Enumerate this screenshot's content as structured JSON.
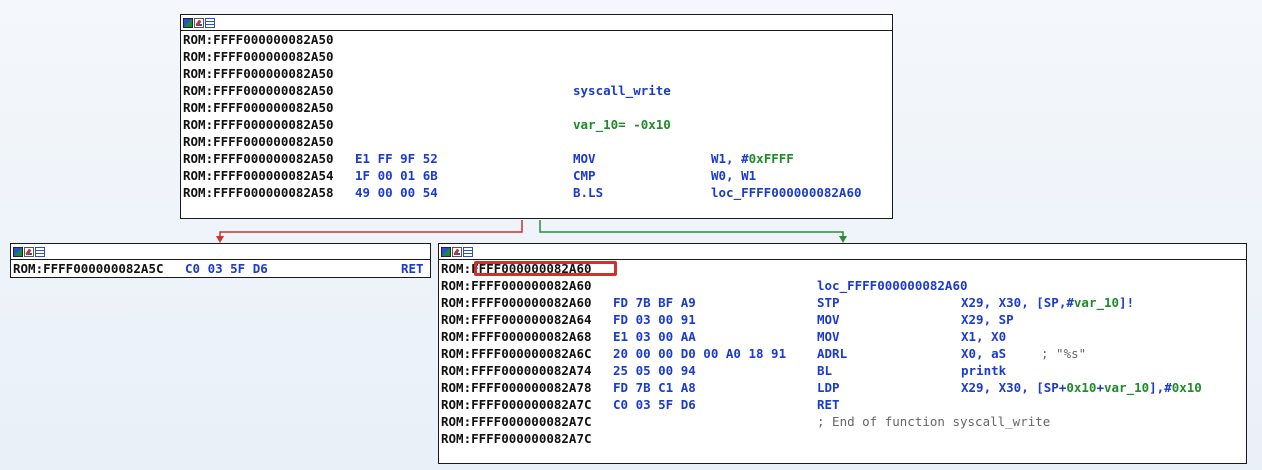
{
  "top_node": {
    "rows": [
      {
        "addr": "ROM:FFFF000000082A50"
      },
      {
        "addr": "ROM:FFFF000000082A50"
      },
      {
        "addr": "ROM:FFFF000000082A50"
      },
      {
        "addr": "ROM:FFFF000000082A50",
        "label": "syscall_write"
      },
      {
        "addr": "ROM:FFFF000000082A50"
      },
      {
        "addr": "ROM:FFFF000000082A50",
        "var": "var_10= -0x10"
      },
      {
        "addr": "ROM:FFFF000000082A50"
      },
      {
        "addr": "ROM:FFFF000000082A50",
        "bytes": "E1 FF 9F 52",
        "mnem": "MOV",
        "ops": "W1, #",
        "num": "0xFFFF"
      },
      {
        "addr": "ROM:FFFF000000082A54",
        "bytes": "1F 00 01 6B",
        "mnem": "CMP",
        "ops": "W0, W1"
      },
      {
        "addr": "ROM:FFFF000000082A58",
        "bytes": "49 00 00 54",
        "mnem": "B.LS",
        "ops": "loc_FFFF000000082A60"
      }
    ]
  },
  "left_node": {
    "rows": [
      {
        "addr": "ROM:FFFF000000082A5C",
        "bytes": "C0 03 5F D6",
        "mnem": "RET"
      }
    ]
  },
  "right_node": {
    "rows": [
      {
        "addr": "ROM:FFFF000000082A60"
      },
      {
        "addr": "ROM:FFFF000000082A60",
        "label": "loc_FFFF000000082A60"
      },
      {
        "addr": "ROM:FFFF000000082A60",
        "bytes": "FD 7B BF A9",
        "mnem": "STP",
        "ops": "X29, X30, [SP,#",
        "var": "var_10",
        "ops2": "]!"
      },
      {
        "addr": "ROM:FFFF000000082A64",
        "bytes": "FD 03 00 91",
        "mnem": "MOV",
        "ops": "X29, SP"
      },
      {
        "addr": "ROM:FFFF000000082A68",
        "bytes": "E1 03 00 AA",
        "mnem": "MOV",
        "ops": "X1, X0"
      },
      {
        "addr": "ROM:FFFF000000082A6C",
        "bytes": "20 00 00 D0 00 A0 18 91",
        "mnem": "ADRL",
        "ops": "X0, aS",
        "cmt": "; \"%s\""
      },
      {
        "addr": "ROM:FFFF000000082A74",
        "bytes": "25 05 00 94",
        "mnem": "BL",
        "ops": "printk"
      },
      {
        "addr": "ROM:FFFF000000082A78",
        "bytes": "FD 7B C1 A8",
        "mnem": "LDP",
        "ops": "X29, X30, [SP+",
        "num": "0x10",
        "ops2": "+",
        "var": "var_10",
        "ops3": "],#",
        "num2": "0x10"
      },
      {
        "addr": "ROM:FFFF000000082A7C",
        "bytes": "C0 03 5F D6",
        "mnem": "RET"
      },
      {
        "addr": "ROM:FFFF000000082A7C",
        "cmt": "; End of function syscall_write"
      },
      {
        "addr": "ROM:FFFF000000082A7C"
      }
    ]
  },
  "colors": {
    "false_edge": "#d0322b",
    "true_edge": "#2e8b3a",
    "highlight": "#d0322b"
  }
}
